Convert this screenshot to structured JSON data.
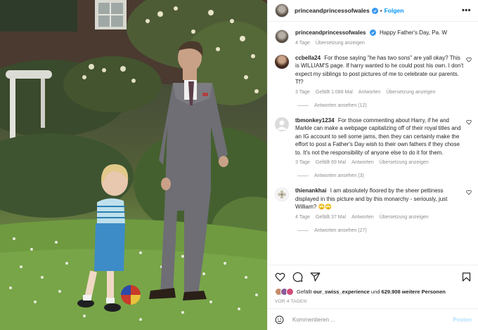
{
  "post": {
    "username": "princeandprincessofwales",
    "follow_label": "Folgen",
    "separator": "•",
    "more_label": "•••"
  },
  "caption": {
    "username": "princeandprincessofwales",
    "text": "Happy Father's Day, Pa. W",
    "age": "4 Tage",
    "translate": "Übersetzung anzeigen"
  },
  "comments": [
    {
      "username": "ccbella24",
      "text": "For those saying \"he has two sons\" are yall okay? This is WILLIAM'S page. If harry wanted to he could post his own. I don't expect my siblings to post pictures of me to celebrate our parents. Tf?",
      "age": "3 Tage",
      "likes": "Gefällt 1.088 Mal",
      "reply": "Antworten",
      "translate": "Übersetzung anzeigen",
      "view_replies": "Antworten ansehen (12)"
    },
    {
      "username": "tbmonkey1234",
      "text": "For those commenting about Harry, if he and Markle can make a webpage capitalizing off of their royal titles and an IG account to sell some jams, then they can certainly make the effort to post a Father's Day wish to their own fathers if they chose to. It's not the responsibility of anyone else to do it for them.",
      "age": "3 Tage",
      "likes": "Gefällt 69 Mal",
      "reply": "Antworten",
      "translate": "Übersetzung anzeigen",
      "view_replies": "Antworten ansehen (3)"
    },
    {
      "username": "thienankhai",
      "text": "I am absolutely floored by the sheer pettiness displayed in this picture and by this monarchy - seriously, just William? 🙄🙄",
      "age": "4 Tage",
      "likes": "Gefällt 37 Mal",
      "reply": "Antworten",
      "translate": "Übersetzung anzeigen",
      "view_replies": "Antworten ansehen (27)"
    }
  ],
  "likes": {
    "prefix": "Gefällt",
    "user": "our_swiss_experience",
    "middle": "und",
    "count": "629.908 weitere Personen"
  },
  "post_age": "VOR 4 TAGEN",
  "comment_input": {
    "placeholder": "Kommentieren ...",
    "post_label": "Posten"
  },
  "colors": {
    "accent": "#0095f6",
    "verified": "#3897f0",
    "muted": "#8e8e8e"
  },
  "icons": [
    "heart-icon",
    "comment-icon",
    "share-icon",
    "bookmark-icon",
    "emoji-icon",
    "more-icon",
    "verified-icon"
  ]
}
